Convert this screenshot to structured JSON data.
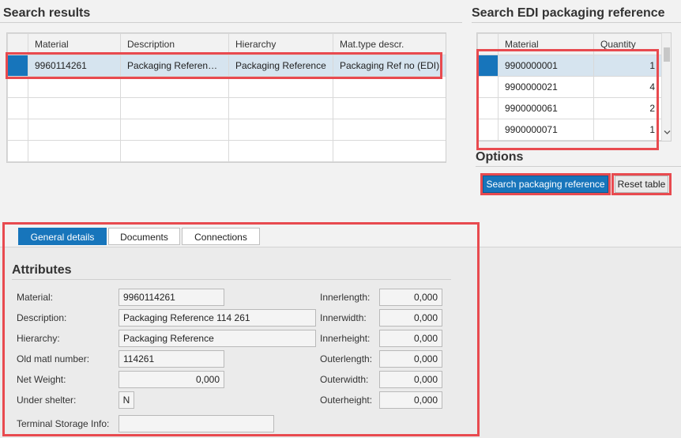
{
  "search_results": {
    "title": "Search results",
    "columns": [
      "Material",
      "Description",
      "Hierarchy",
      "Mat.type descr."
    ],
    "rows": [
      [
        "9960114261",
        "Packaging Referen…",
        "Packaging Reference",
        "Packaging Ref no (EDI)"
      ],
      [
        "",
        "",
        "",
        ""
      ],
      [
        "",
        "",
        "",
        ""
      ],
      [
        "",
        "",
        "",
        ""
      ],
      [
        "",
        "",
        "",
        ""
      ]
    ]
  },
  "edi": {
    "title": "Search EDI packaging reference",
    "columns": [
      "Material",
      "Quantity"
    ],
    "rows": [
      [
        "9900000001",
        "1"
      ],
      [
        "9900000021",
        "4"
      ],
      [
        "9900000061",
        "2"
      ],
      [
        "9900000071",
        "1"
      ]
    ]
  },
  "options": {
    "title": "Options",
    "search_btn": "Search packaging reference",
    "reset_btn": "Reset table"
  },
  "tabs": [
    "General details",
    "Documents",
    "Connections"
  ],
  "attributes": {
    "title": "Attributes",
    "left": [
      {
        "label": "Material:",
        "value": "9960114261"
      },
      {
        "label": "Description:",
        "value": "Packaging Reference 114 261"
      },
      {
        "label": "Hierarchy:",
        "value": "Packaging Reference"
      },
      {
        "label": "Old matl number:",
        "value": "114261"
      },
      {
        "label": "Net Weight:",
        "value": "0,000"
      },
      {
        "label": "Under shelter:",
        "value": "N"
      },
      {
        "label": "Terminal Storage Info:",
        "value": ""
      }
    ],
    "right": [
      {
        "label": "Innerlength:",
        "value": "0,000"
      },
      {
        "label": "Innerwidth:",
        "value": "0,000"
      },
      {
        "label": "Innerheight:",
        "value": "0,000"
      },
      {
        "label": "Outerlength:",
        "value": "0,000"
      },
      {
        "label": "Outerwidth:",
        "value": "0,000"
      },
      {
        "label": "Outerheight:",
        "value": "0,000"
      }
    ]
  },
  "colors": {
    "accent": "#1775bb",
    "selected_row": "#d6e4ef",
    "highlight_box": "#e84a4f"
  }
}
